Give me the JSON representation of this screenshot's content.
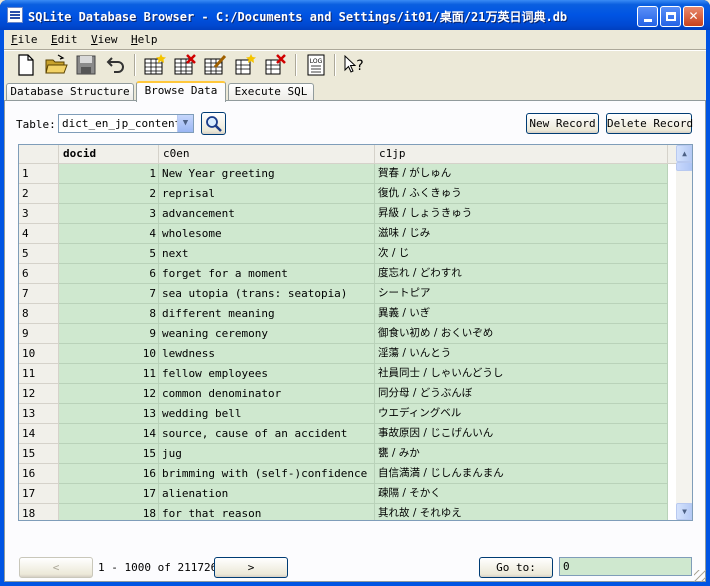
{
  "window": {
    "title": "SQLite Database Browser - C:/Documents and Settings/it01/桌面/21万英日词典.db",
    "minimize_icon": "minimize-icon",
    "maximize_icon": "maximize-icon",
    "close_icon": "close-icon"
  },
  "menu": [
    {
      "label": "File"
    },
    {
      "label": "Edit"
    },
    {
      "label": "View"
    },
    {
      "label": "Help"
    }
  ],
  "toolbar_icons": [
    "new-file-icon",
    "open-folder-icon",
    "save-icon",
    "undo-icon",
    "create-table-icon",
    "delete-table-icon",
    "modify-table-icon",
    "create-index-icon",
    "delete-index-icon",
    "log-icon",
    "whats-this-icon"
  ],
  "toolbar_log_text": "LOG",
  "tabs": [
    {
      "label": "Database Structure"
    },
    {
      "label": "Browse Data",
      "active": true
    },
    {
      "label": "Execute SQL"
    }
  ],
  "browse": {
    "table_label": "Table:",
    "table_value": "dict_en_jp_content",
    "new_record": "New Record",
    "delete_record": "Delete Record"
  },
  "grid": {
    "headers": [
      "docid",
      "c0en",
      "c1jp"
    ],
    "rows": [
      {
        "num": "1",
        "docid": "1",
        "en": "New Year greeting",
        "jp": "賀春 / がしゅん"
      },
      {
        "num": "2",
        "docid": "2",
        "en": "reprisal",
        "jp": "復仇 / ふくきゅう"
      },
      {
        "num": "3",
        "docid": "3",
        "en": "advancement",
        "jp": "昇級 / しょうきゅう"
      },
      {
        "num": "4",
        "docid": "4",
        "en": "wholesome",
        "jp": "滋味 / じみ"
      },
      {
        "num": "5",
        "docid": "5",
        "en": "next",
        "jp": "次 / じ"
      },
      {
        "num": "6",
        "docid": "6",
        "en": "forget for a moment",
        "jp": "度忘れ / どわすれ"
      },
      {
        "num": "7",
        "docid": "7",
        "en": "sea utopia (trans: seatopia)",
        "jp": "シートピア"
      },
      {
        "num": "8",
        "docid": "8",
        "en": "different meaning",
        "jp": "異義 / いぎ"
      },
      {
        "num": "9",
        "docid": "9",
        "en": "weaning ceremony",
        "jp": "御食い初め / おくいぞめ"
      },
      {
        "num": "10",
        "docid": "10",
        "en": "lewdness",
        "jp": "淫蕩 / いんとう"
      },
      {
        "num": "11",
        "docid": "11",
        "en": "fellow employees",
        "jp": "社員同士 / しゃいんどうし"
      },
      {
        "num": "12",
        "docid": "12",
        "en": "common denominator",
        "jp": "同分母 / どうぶんぼ"
      },
      {
        "num": "13",
        "docid": "13",
        "en": "wedding bell",
        "jp": "ウエディングベル"
      },
      {
        "num": "14",
        "docid": "14",
        "en": "source, cause of an accident",
        "jp": "事故原因 / じこげんいん"
      },
      {
        "num": "15",
        "docid": "15",
        "en": "jug",
        "jp": "甕 / みか"
      },
      {
        "num": "16",
        "docid": "16",
        "en": "brimming with (self-)confidence",
        "jp": "自信満満 / じしんまんまん"
      },
      {
        "num": "17",
        "docid": "17",
        "en": "alienation",
        "jp": "疎隔 / そかく"
      },
      {
        "num": "18",
        "docid": "18",
        "en": "for that reason",
        "jp": "其れ故 / それゆえ"
      }
    ]
  },
  "footer": {
    "prev_icon": "chevron-left-icon",
    "next_icon": "chevron-right-icon",
    "prev_glyph": "<",
    "next_glyph": ">",
    "range": "1 - 1000 of 211726",
    "goto_label": "Go to:",
    "goto_value": "0"
  },
  "colors": {
    "titlebar": "#0054e3",
    "cell_bg": "#cfe8cf",
    "active_tab_accent": "#ffc83c"
  }
}
